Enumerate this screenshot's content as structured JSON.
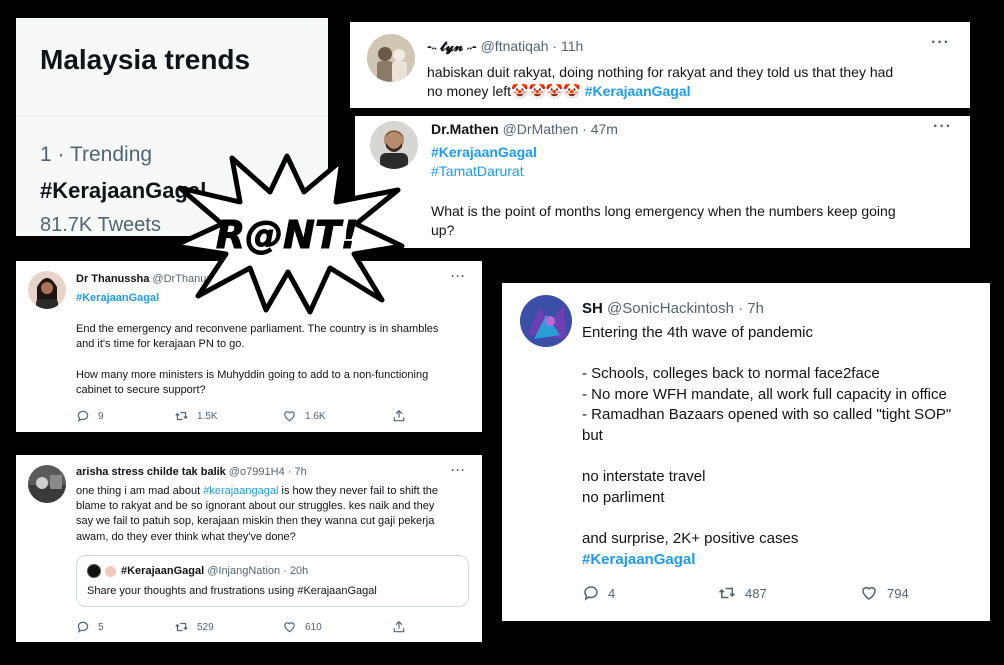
{
  "trends": {
    "title": "Malaysia trends",
    "rank_label": "1 · Trending",
    "hashtag": "#KerajaanGagal",
    "tweet_count": "81.7K Tweets"
  },
  "rant_sticker": {
    "text": "R@NT!"
  },
  "tweets": [
    {
      "display_name": "-˵ 𝓽𝔂𝓷 ˶-",
      "handle": "@ftnatiqah",
      "time": "· 11h",
      "line1": "habiskan duit rakyat, doing nothing for rakyat and they told us that they had",
      "line2": "no money left",
      "emoji": "🤡🤡🤡🤡",
      "hashtag": "#KerajaanGagal",
      "more": "···"
    },
    {
      "display_name": "Dr.Mathen",
      "handle": "@DrMathen",
      "time": "· 47m",
      "hashtag1": "#KerajaanGagal",
      "hashtag2": "#TamatDarurat",
      "line1": "What is the point of months long emergency when the numbers keep going",
      "line2": "up?",
      "more": "···"
    },
    {
      "display_name": "Dr Thanussha",
      "handle": "@DrThanussha",
      "hashtag": "#KerajaanGagal",
      "p1_line1": "End the emergency and reconvene parliament. The country is in shambles",
      "p1_line2": "and it's time for kerajaan PN to go.",
      "p2_line1": "How many more ministers is Muhyddin going to add to a non-functioning",
      "p2_line2": "cabinet to secure support?",
      "replies": "9",
      "retweets": "1.5K",
      "likes": "1.6K",
      "more": "···"
    },
    {
      "display_name": "arisha stress childe tak balik",
      "handle": "@o7991H4",
      "time": "· 7h",
      "l1_a": "one thing i am mad about ",
      "l1_tag": "#kerajaangagal",
      "l1_b": " is how they never fail to shift the",
      "l2": "blame to rakyat and be so ignorant about our struggles. kes naik and they",
      "l3": "say we fail to patuh sop, kerajaan miskin then they wanna cut gaji pekerja",
      "l4": "awam, do they ever think what they've done?",
      "quote": {
        "name": "#KerajaanGagal",
        "handle": "@InjangNation",
        "time": "· 20h",
        "text": "Share your thoughts and frustrations using #KerajaanGagal"
      },
      "replies": "5",
      "retweets": "529",
      "likes": "610",
      "more": "···"
    },
    {
      "display_name": "SH",
      "handle": "@SonicHackintosh",
      "time": "· 7h",
      "l1": "Entering the 4th wave of pandemic",
      "l2": "- Schools, colleges back to normal face2face",
      "l3": "- No more WFH mandate, all work full capacity in office",
      "l4": "- Ramadhan Bazaars opened with so called \"tight SOP\"",
      "l5": "but",
      "l6": "no interstate travel",
      "l7": "no parliment",
      "l8": "and surprise, 2K+ positive cases",
      "hashtag": "#KerajaanGagal",
      "replies": "4",
      "retweets": "487",
      "likes": "794"
    }
  ],
  "colors": {
    "link": "#1d9bf0",
    "muted": "#536471",
    "text": "#0f1419",
    "background": "#000000"
  }
}
